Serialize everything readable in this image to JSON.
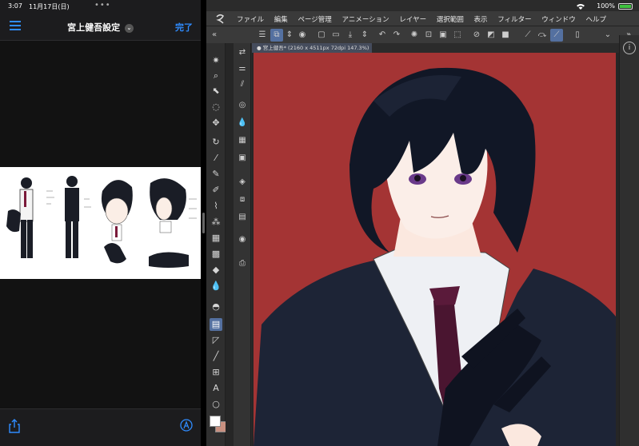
{
  "left_pane": {
    "time": "3:07",
    "date": "11月17日(日)",
    "title": "宮上健吾設定",
    "done_label": "完了"
  },
  "right_pane": {
    "battery_percent": "100%",
    "menu": [
      "ファイル",
      "編集",
      "ページ管理",
      "アニメーション",
      "レイヤー",
      "選択範囲",
      "表示",
      "フィルター",
      "ウィンドウ",
      "ヘルプ"
    ],
    "document_tab": "● 宮上健吾* (2160 x 4511px 72dpi 147.3%)",
    "canvas_color": "#a43434"
  },
  "colors": {
    "accent": "#2f8cff",
    "active_tool": "#5470a0"
  }
}
